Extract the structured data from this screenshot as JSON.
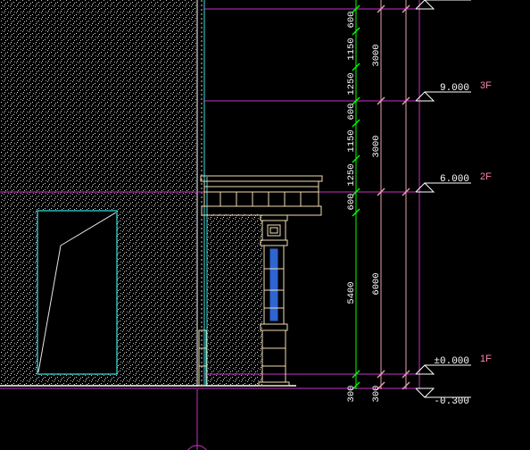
{
  "colors": {
    "background": "#000000",
    "grid_magenta": "#c832c8",
    "dim_green": "#00ff00",
    "dim_pink": "#e8a0b0",
    "tag_pink": "#ff7fae",
    "cyan": "#40e0e0",
    "ornament": "#f0dcb4",
    "blue_glass": "#2f64d2",
    "white": "#ffffff"
  },
  "dimensions": {
    "inner_chain": [
      "600",
      "1150",
      "1250",
      "600",
      "1150",
      "1250",
      "600",
      "5400",
      "300"
    ],
    "outer_chain": [
      "3000",
      "3000",
      "6000",
      "300"
    ]
  },
  "levels": [
    {
      "elev": "9.000",
      "floor": "3F"
    },
    {
      "elev": "6.000",
      "floor": "2F"
    },
    {
      "elev": "±0.000",
      "floor": "1F"
    },
    {
      "elev": "-0.300",
      "floor": ""
    }
  ],
  "icons": {
    "level_marker": "triangle-level-marker-icon",
    "axis_bubble": "grid-axis-bubble-icon"
  }
}
